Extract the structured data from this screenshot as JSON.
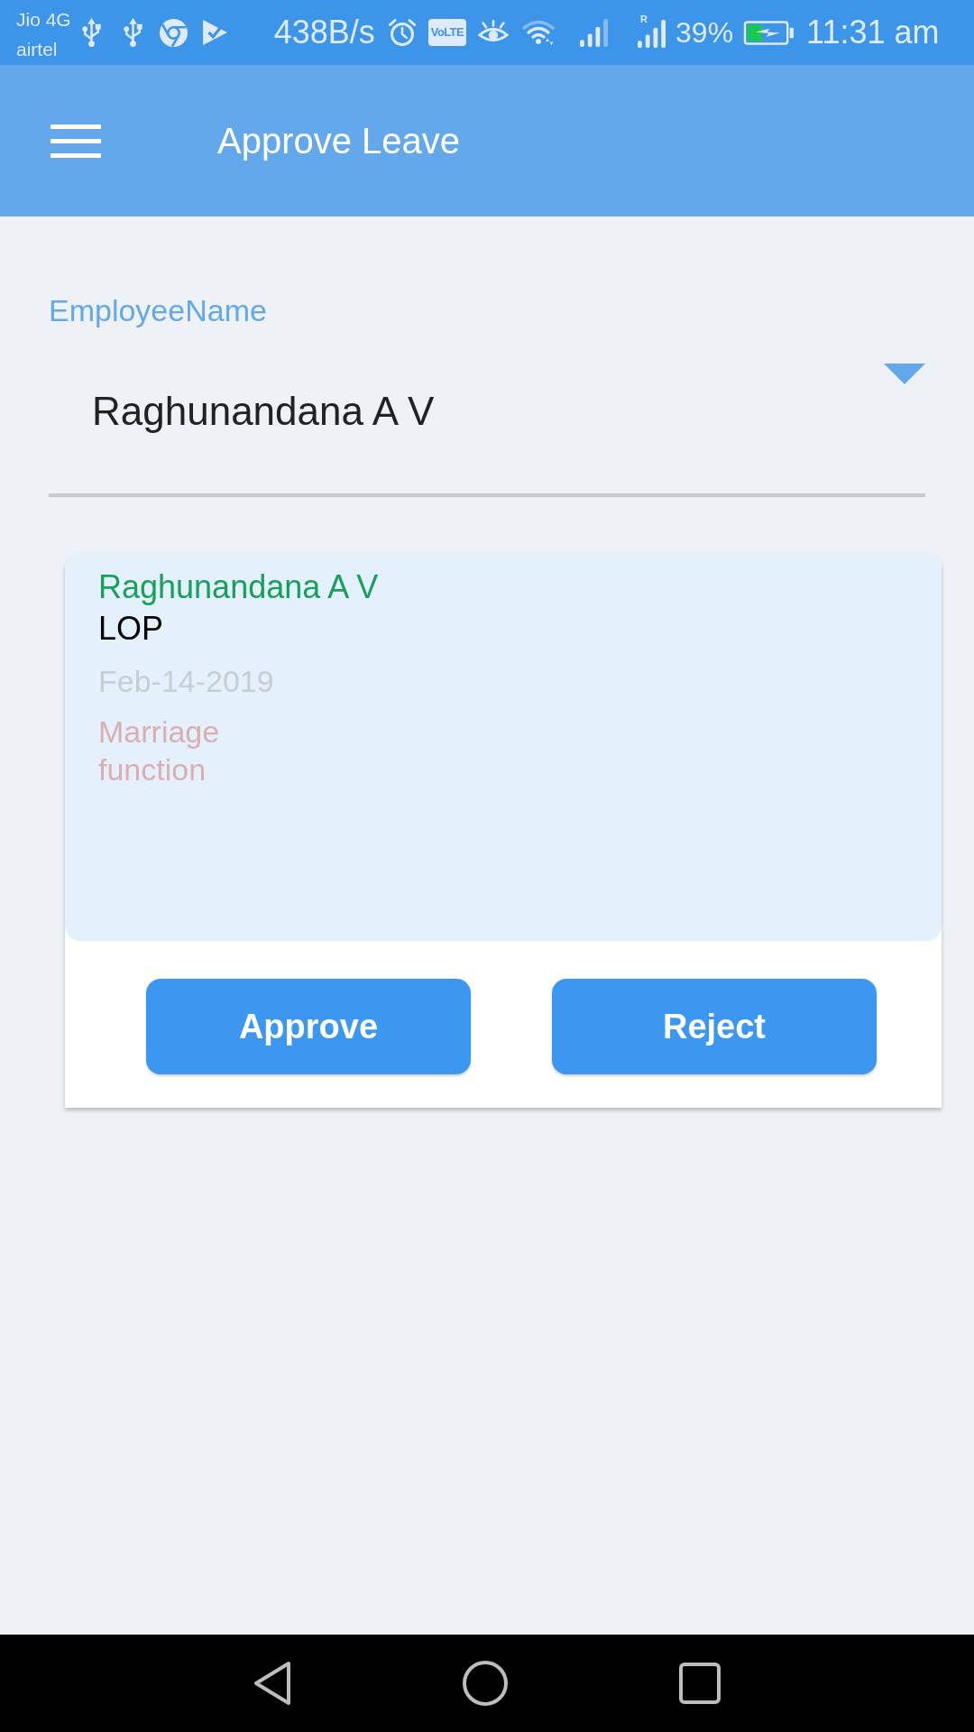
{
  "status_bar": {
    "carrier_lines": [
      "Jio 4G",
      "airtel"
    ],
    "data_speed": "438B/s",
    "volte": "VoLTE",
    "roaming": "R",
    "battery": "39%",
    "charging": true,
    "time": "11:31 am"
  },
  "app_bar": {
    "title": "Approve Leave"
  },
  "employee_select": {
    "label": "EmployeeName",
    "value": "Raghunandana A V"
  },
  "leave_requests": [
    {
      "employee": "Raghunandana A V",
      "leave_type": "LOP",
      "date": "Feb-14-2019",
      "reason": "Marriage function",
      "actions": [
        "Approve",
        "Reject"
      ]
    }
  ]
}
